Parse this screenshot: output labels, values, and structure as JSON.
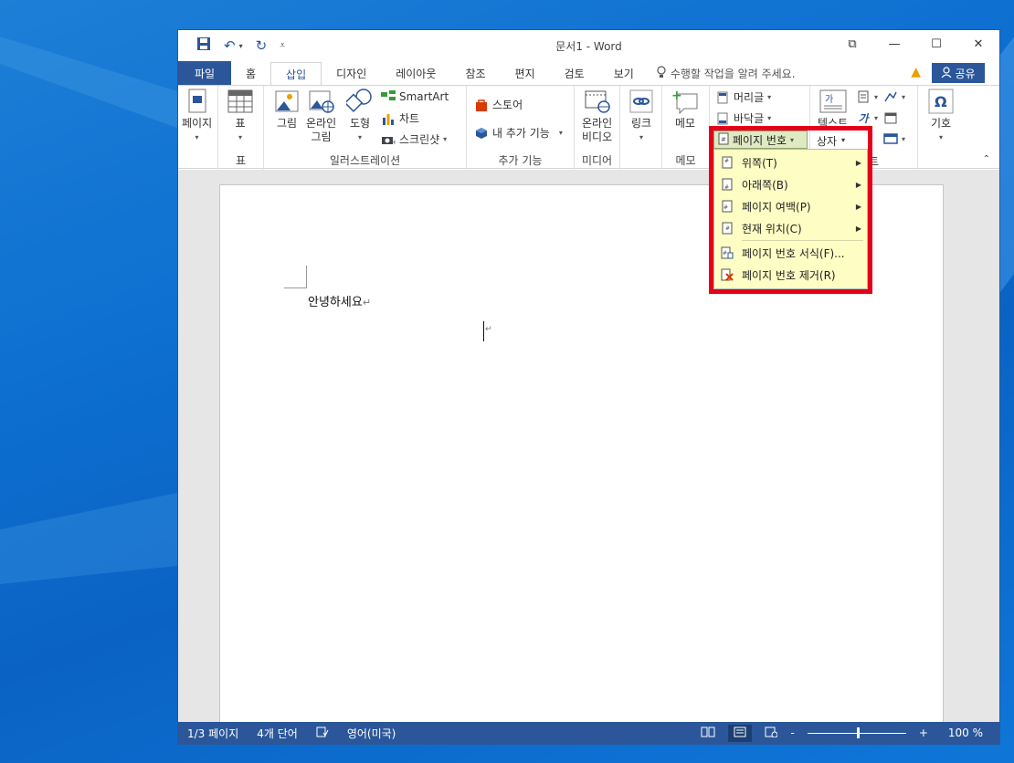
{
  "window": {
    "title": "문서1 - Word",
    "minimize": "—",
    "maximize": "☐",
    "close": "✕",
    "restore_icon": "⧉"
  },
  "qat": {
    "save_icon": "💾",
    "undo_icon": "↶",
    "redo_icon": "↻",
    "customize_icon": "⩡"
  },
  "tabs": {
    "file": "파일",
    "home": "홈",
    "insert": "삽입",
    "design": "디자인",
    "layout": "레이아웃",
    "references": "참조",
    "mailings": "편지",
    "review": "검토",
    "view": "보기",
    "tell_me": "수행할 작업을 알려 주세요.",
    "share": "공유"
  },
  "ribbon": {
    "pages": {
      "button": "페이지"
    },
    "tables": {
      "button": "표",
      "group": "표"
    },
    "illustrations": {
      "picture": "그림",
      "online_picture_1": "온라인",
      "online_picture_2": "그림",
      "shapes": "도형",
      "smartart": "SmartArt",
      "chart": "차트",
      "screenshot": "스크린샷",
      "group": "일러스트레이션"
    },
    "addins": {
      "store": "스토어",
      "my_addins": "내 추가 기능",
      "group": "추가 기능"
    },
    "media": {
      "online_video_1": "온라인",
      "online_video_2": "비디오",
      "group": "미디어"
    },
    "links": {
      "link": "링크"
    },
    "comments": {
      "comment": "메모",
      "group": "메모"
    },
    "header_footer": {
      "header": "머리글",
      "footer": "바닥글",
      "page_number": "페이지 번호"
    },
    "text": {
      "textbox_1": "텍스트",
      "textbox_2": "상자",
      "group_partial": "트"
    },
    "symbols": {
      "symbol": "기호"
    }
  },
  "menu": {
    "items": [
      {
        "label": "위쪽(T)",
        "has_submenu": true
      },
      {
        "label": "아래쪽(B)",
        "has_submenu": true
      },
      {
        "label": "페이지 여백(P)",
        "has_submenu": true
      },
      {
        "label": "현재 위치(C)",
        "has_submenu": true
      },
      {
        "label": "페이지 번호 서식(F)...",
        "has_submenu": false
      },
      {
        "label": "페이지 번호 제거(R)",
        "has_submenu": false
      }
    ]
  },
  "document": {
    "text": "안녕하세요",
    "para_mark": "↵"
  },
  "status": {
    "page": "1/3 페이지",
    "words": "4개 단어",
    "language": "영어(미국)",
    "zoom": "100 %",
    "zoom_minus": "-",
    "zoom_plus": "+"
  },
  "colors": {
    "accent": "#2b579a",
    "highlight": "#e3001b",
    "menu_bg": "#fdfdc4"
  }
}
